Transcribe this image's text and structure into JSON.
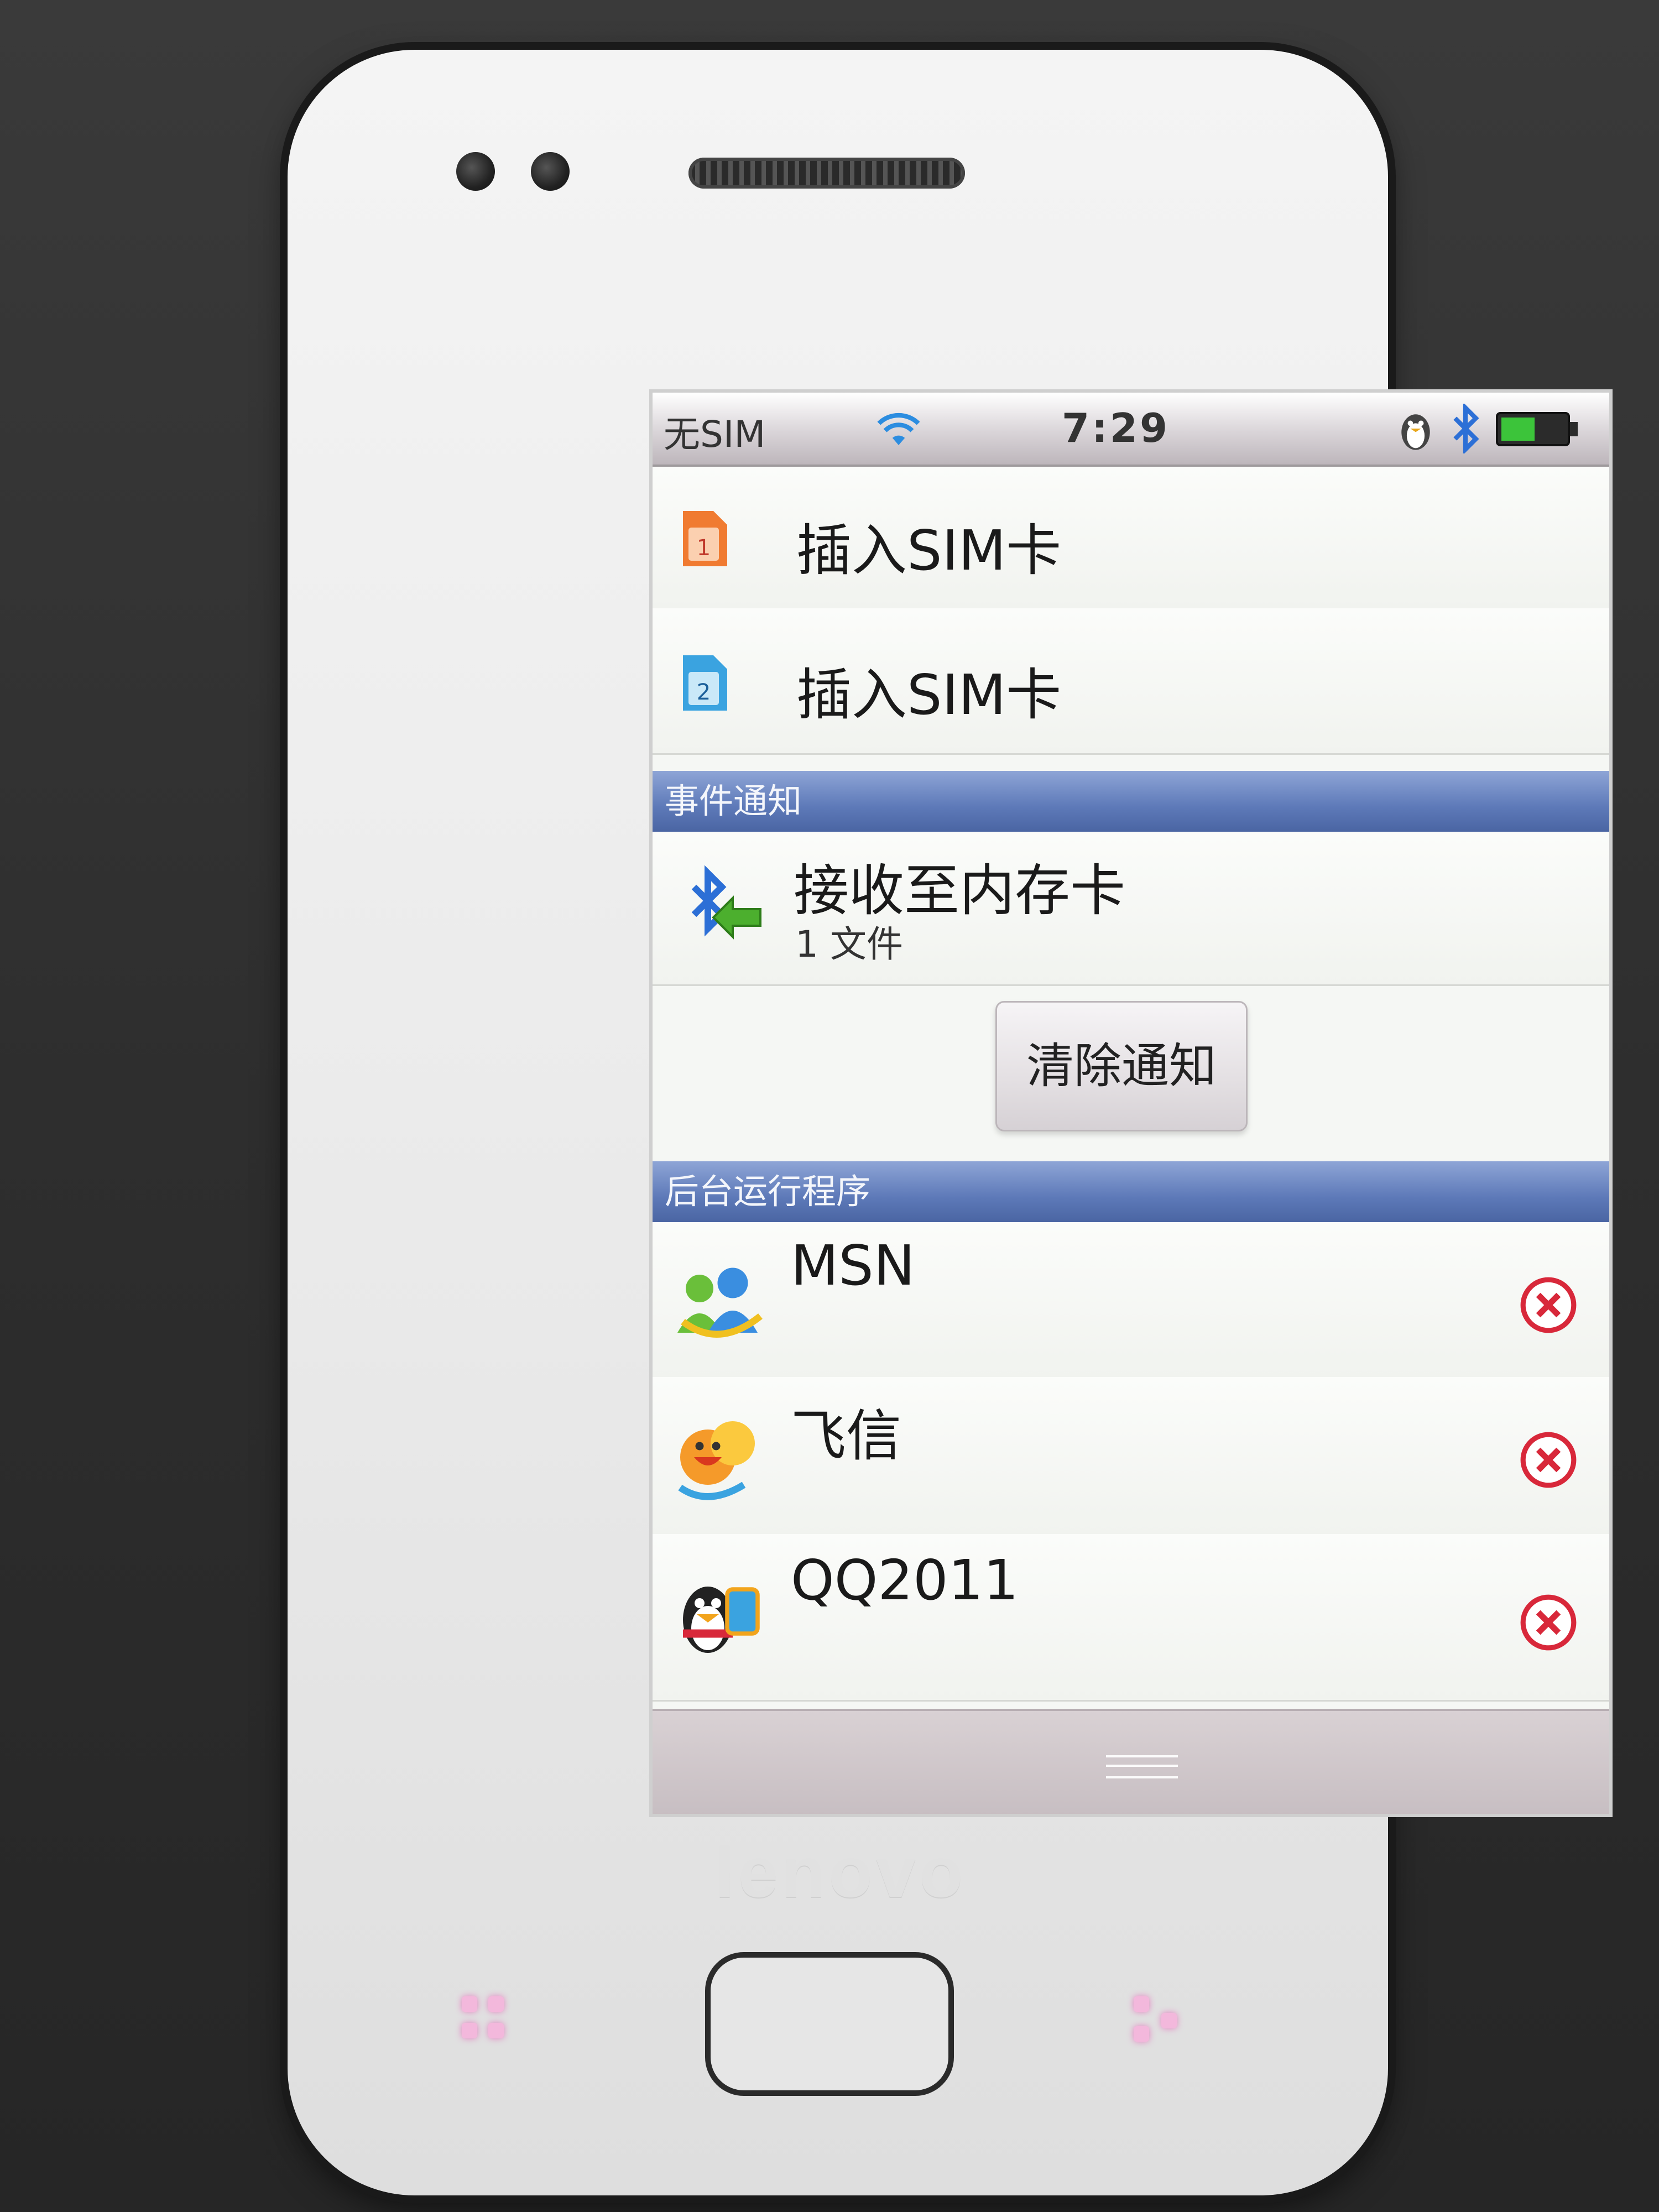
{
  "device": {
    "brand": "lenovo"
  },
  "status_bar": {
    "carrier": "无SIM",
    "time": "7:29",
    "icons": [
      "wifi-icon",
      "qq-status-icon",
      "bluetooth-icon",
      "battery-icon"
    ]
  },
  "sim_rows": [
    {
      "label": "插入SIM卡",
      "icon": "sim1-icon"
    },
    {
      "label": "插入SIM卡",
      "icon": "sim2-icon"
    }
  ],
  "notifications": {
    "header": "事件通知",
    "items": [
      {
        "title": "接收至内存卡",
        "subtitle": "1 文件",
        "icon": "bluetooth-receive-icon"
      }
    ],
    "clear_button": "清除通知"
  },
  "running_apps": {
    "header": "后台运行程序",
    "items": [
      {
        "name": "MSN",
        "icon": "msn-icon"
      },
      {
        "name": "飞信",
        "icon": "fetion-icon"
      },
      {
        "name": "QQ2011",
        "icon": "qq-icon"
      }
    ]
  },
  "colors": {
    "section_header": "#5d79b8",
    "close_red": "#d8283a",
    "battery_green": "#3cc43a"
  }
}
